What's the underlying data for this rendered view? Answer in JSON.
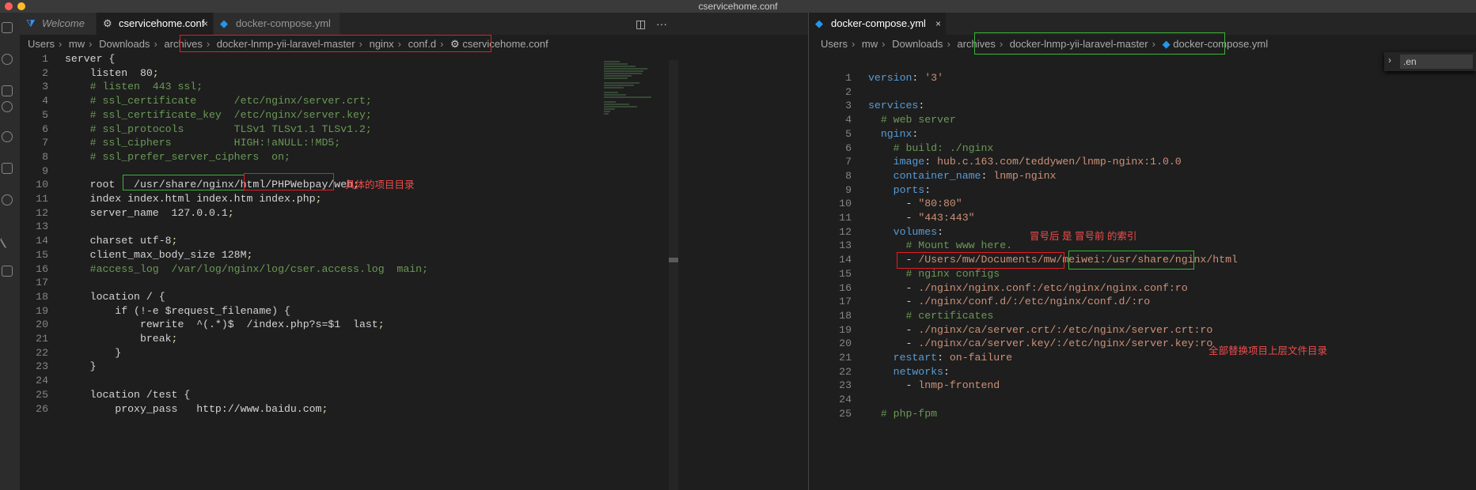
{
  "window": {
    "title": "cservicehome.conf"
  },
  "left": {
    "tabs": [
      {
        "label": "Welcome",
        "icon": "vscode-icon"
      },
      {
        "label": "cservicehome.conf",
        "icon": "gear-icon",
        "close": "×"
      },
      {
        "label": "docker-compose.yml",
        "icon": "docker-icon"
      }
    ],
    "actions": {
      "split": "◫",
      "more": "···"
    },
    "breadcrumbs": [
      "Users",
      "mw",
      "Downloads",
      "archives",
      "docker-lnmp-yii-laravel-master",
      "nginx",
      "conf.d",
      "cservicehome.conf"
    ],
    "lines": [
      {
        "n": "1",
        "t": "server {"
      },
      {
        "n": "2",
        "t": "    listen  80;"
      },
      {
        "n": "3",
        "t": "    # listen  443 ssl;"
      },
      {
        "n": "4",
        "t": "    # ssl_certificate      /etc/nginx/server.crt;"
      },
      {
        "n": "5",
        "t": "    # ssl_certificate_key  /etc/nginx/server.key;"
      },
      {
        "n": "6",
        "t": "    # ssl_protocols        TLSv1 TLSv1.1 TLSv1.2;"
      },
      {
        "n": "7",
        "t": "    # ssl_ciphers          HIGH:!aNULL:!MD5;"
      },
      {
        "n": "8",
        "t": "    # ssl_prefer_server_ciphers  on;"
      },
      {
        "n": "9",
        "t": ""
      },
      {
        "n": "10",
        "t": "    root   /usr/share/nginx/html/PHPWebpay/web;"
      },
      {
        "n": "11",
        "t": "    index index.html index.htm index.php;"
      },
      {
        "n": "12",
        "t": "    server_name  127.0.0.1;"
      },
      {
        "n": "13",
        "t": ""
      },
      {
        "n": "14",
        "t": "    charset utf-8;"
      },
      {
        "n": "15",
        "t": "    client_max_body_size 128M;"
      },
      {
        "n": "16",
        "t": "    #access_log  /var/log/nginx/log/cser.access.log  main;"
      },
      {
        "n": "17",
        "t": ""
      },
      {
        "n": "18",
        "t": "    location / {"
      },
      {
        "n": "19",
        "t": "        if (!-e $request_filename) {"
      },
      {
        "n": "20",
        "t": "            rewrite  ^(.*)$  /index.php?s=$1  last;"
      },
      {
        "n": "21",
        "t": "            break;"
      },
      {
        "n": "22",
        "t": "        }"
      },
      {
        "n": "23",
        "t": "    }"
      },
      {
        "n": "24",
        "t": ""
      },
      {
        "n": "25",
        "t": "    location /test {"
      },
      {
        "n": "26",
        "t": "        proxy_pass   http://www.baidu.com;"
      }
    ],
    "annotation": "具体的项目目录"
  },
  "right": {
    "tabs": [
      {
        "label": "docker-compose.yml",
        "icon": "docker-icon",
        "close": "×"
      }
    ],
    "breadcrumbs": [
      "Users",
      "mw",
      "Downloads",
      "archives",
      "docker-lnmp-yii-laravel-master",
      "docker-compose.yml"
    ],
    "find_value": ".en",
    "lines": [
      {
        "n": "1",
        "t": "version: '3'"
      },
      {
        "n": "2",
        "t": ""
      },
      {
        "n": "3",
        "t": "services:"
      },
      {
        "n": "4",
        "t": "  # web server"
      },
      {
        "n": "5",
        "t": "  nginx:"
      },
      {
        "n": "6",
        "t": "    # build: ./nginx"
      },
      {
        "n": "7",
        "t": "    image: hub.c.163.com/teddywen/lnmp-nginx:1.0.0"
      },
      {
        "n": "8",
        "t": "    container_name: lnmp-nginx"
      },
      {
        "n": "9",
        "t": "    ports:"
      },
      {
        "n": "10",
        "t": "      - \"80:80\""
      },
      {
        "n": "11",
        "t": "      - \"443:443\""
      },
      {
        "n": "12",
        "t": "    volumes:"
      },
      {
        "n": "13",
        "t": "      # Mount www here."
      },
      {
        "n": "14",
        "t": "      - /Users/mw/Documents/mw/meiwei:/usr/share/nginx/html"
      },
      {
        "n": "15",
        "t": "      # nginx configs"
      },
      {
        "n": "16",
        "t": "      - ./nginx/nginx.conf:/etc/nginx/nginx.conf:ro"
      },
      {
        "n": "17",
        "t": "      - ./nginx/conf.d/:/etc/nginx/conf.d/:ro"
      },
      {
        "n": "18",
        "t": "      # certificates"
      },
      {
        "n": "19",
        "t": "      - ./nginx/ca/server.crt/:/etc/nginx/server.crt:ro"
      },
      {
        "n": "20",
        "t": "      - ./nginx/ca/server.key/:/etc/nginx/server.key:ro"
      },
      {
        "n": "21",
        "t": "    restart: on-failure"
      },
      {
        "n": "22",
        "t": "    networks:"
      },
      {
        "n": "23",
        "t": "      - lnmp-frontend"
      },
      {
        "n": "24",
        "t": ""
      },
      {
        "n": "25",
        "t": "  # php-fpm"
      }
    ],
    "annotations": {
      "colon": "冒号后 是 冒号前 的索引",
      "replace": "全部替换项目上层文件目录"
    }
  },
  "colors": {
    "keyword": "#569cd6",
    "string": "#ce9178",
    "comment": "#6a9955",
    "annotation": "#f14c4c"
  }
}
